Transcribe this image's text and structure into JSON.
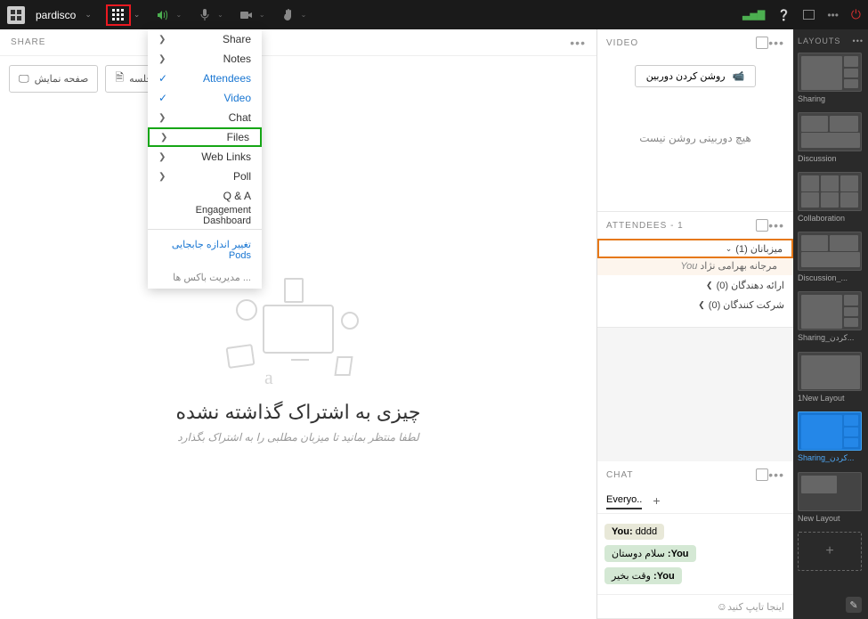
{
  "topbar": {
    "title": "pardisco"
  },
  "share": {
    "header": "SHARE",
    "btn_screen": "صفحه نمایش",
    "btn_files": "فایل های جلسه",
    "title": "چیزی به اشتراک گذاشته نشده",
    "subtitle": "لطفا منتظر بمانید تا میزبان مطلبی را به اشتراک بگذارد"
  },
  "pods_menu": {
    "share": "Share",
    "notes": "Notes",
    "attendees": "Attendees",
    "video": "Video",
    "chat": "Chat",
    "files": "Files",
    "weblinks": "Web Links",
    "poll": "Poll",
    "qa": "Q & A",
    "engagement": "Engagement Dashboard",
    "resize": "تغییر اندازه جابجایی Pods",
    "manage": "مدیریت باکس ها ..."
  },
  "video": {
    "header": "VIDEO",
    "btn": "روشن کردن دوربین",
    "msg": "هیچ دوربینی روشن نیست"
  },
  "attendees": {
    "header": "ATTENDEES",
    "count": "- 1",
    "hosts": "میزبانان (1)",
    "user_you": "You",
    "user_name": "مرجانه بهرامی نژاد",
    "presenters": "ارائه دهندگان (0)",
    "participants": "شرکت کنندگان (0)"
  },
  "chat": {
    "header": "CHAT",
    "tab": "Everyo..",
    "msg1_you": "You:",
    "msg1_text": "dddd",
    "msg2_you": "You:",
    "msg2_text": "سلام دوستان",
    "msg3_you": "You:",
    "msg3_text": "وقت بخیر",
    "placeholder": "اینجا تایپ کنید"
  },
  "layouts": {
    "header": "LAYOUTS",
    "items": [
      "Sharing",
      "Discussion",
      "Collaboration",
      "Discussion_...",
      "Sharing_کردن...",
      "1New Layout",
      "Sharing_کردن...",
      "New Layout"
    ]
  }
}
